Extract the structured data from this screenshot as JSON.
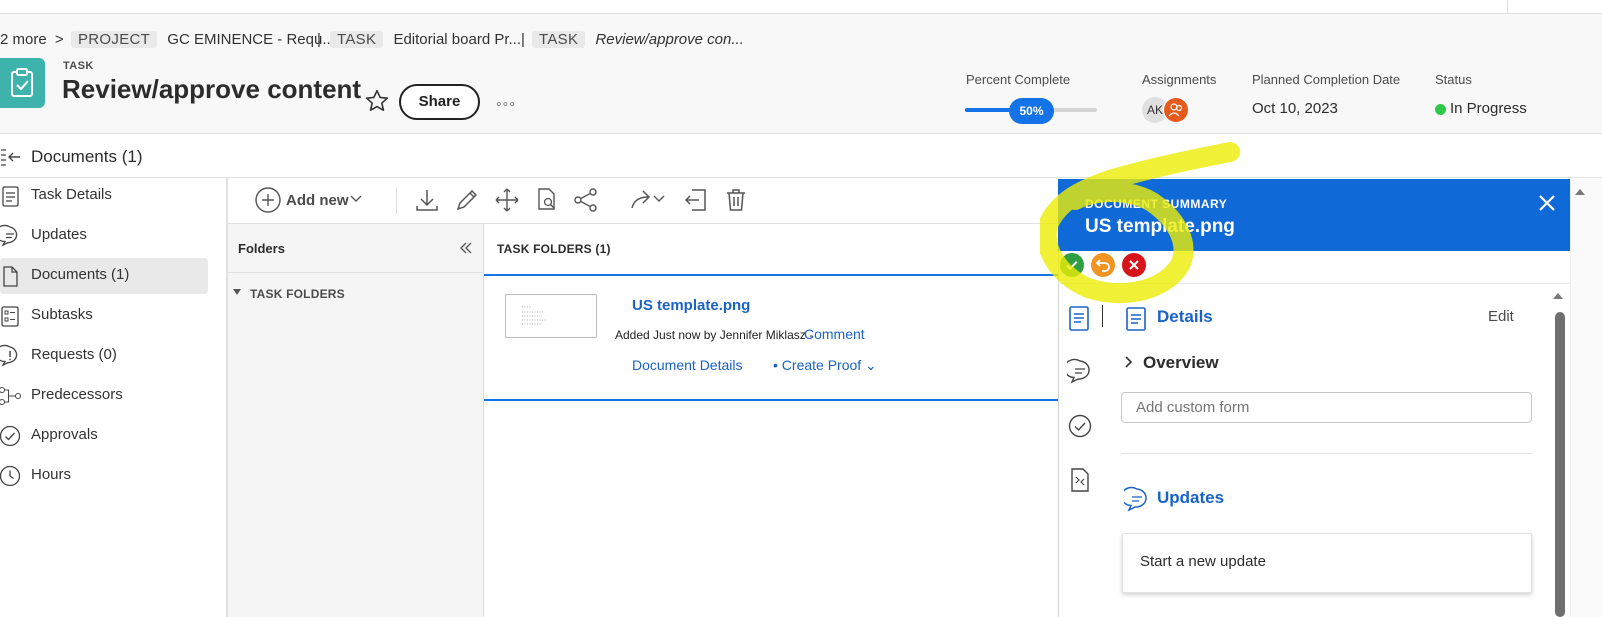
{
  "breadcrumb": {
    "more": "2 more",
    "chevron": ">",
    "items": [
      {
        "type": "PROJECT",
        "label": "GC EMINENCE - Requ..."
      },
      {
        "type": "TASK",
        "label": "Editorial board Pr..."
      },
      {
        "type": "TASK",
        "label": "Review/approve con..."
      }
    ],
    "separator": "|"
  },
  "task": {
    "type_label": "TASK",
    "title": "Review/approve content",
    "share_label": "Share",
    "more_label": "◦◦◦"
  },
  "stats": {
    "percent_label": "Percent Complete",
    "percent_value": 50,
    "percent_text": "50%",
    "assignments_label": "Assignments",
    "assignee_initials": "AK",
    "planned_label": "Planned Completion Date",
    "planned_value": "Oct 10, 2023",
    "status_label": "Status",
    "status_value": "In Progress",
    "status_color": "#2ec946"
  },
  "docs_bar": {
    "title": "Documents (1)"
  },
  "nav": {
    "items": [
      {
        "label": "Task Details",
        "icon": "document-icon"
      },
      {
        "label": "Updates",
        "icon": "chat-icon"
      },
      {
        "label": "Documents (1)",
        "icon": "file-icon",
        "selected": true
      },
      {
        "label": "Subtasks",
        "icon": "checklist-icon"
      },
      {
        "label": "Requests (0)",
        "icon": "alert-bubble-icon"
      },
      {
        "label": "Predecessors",
        "icon": "dependency-icon"
      },
      {
        "label": "Approvals",
        "icon": "check-circle-icon"
      },
      {
        "label": "Hours",
        "icon": "clock-icon"
      }
    ]
  },
  "toolbar": {
    "add_new_label": "Add new"
  },
  "folders": {
    "header": "Folders",
    "tree_root": "TASK FOLDERS"
  },
  "list": {
    "header": "TASK FOLDERS (1)",
    "document": {
      "name": "US template.png",
      "added": "Added Just now by Jennifer Miklasz -",
      "comment_label": "Comment",
      "details_label": "Document Details",
      "create_proof_label": "• Create Proof ⌄"
    }
  },
  "summary": {
    "kicker": "DOCUMENT SUMMARY",
    "title": "US template.png",
    "details_title": "Details",
    "edit_label": "Edit",
    "overview_label": "Overview",
    "custom_form_placeholder": "Add custom form",
    "updates_title": "Updates",
    "new_update_label": "Start a new update",
    "header_color": "#0f6ad8",
    "approve_color": "#2ea043",
    "return_color": "#f29423",
    "reject_color": "#d7141a"
  }
}
